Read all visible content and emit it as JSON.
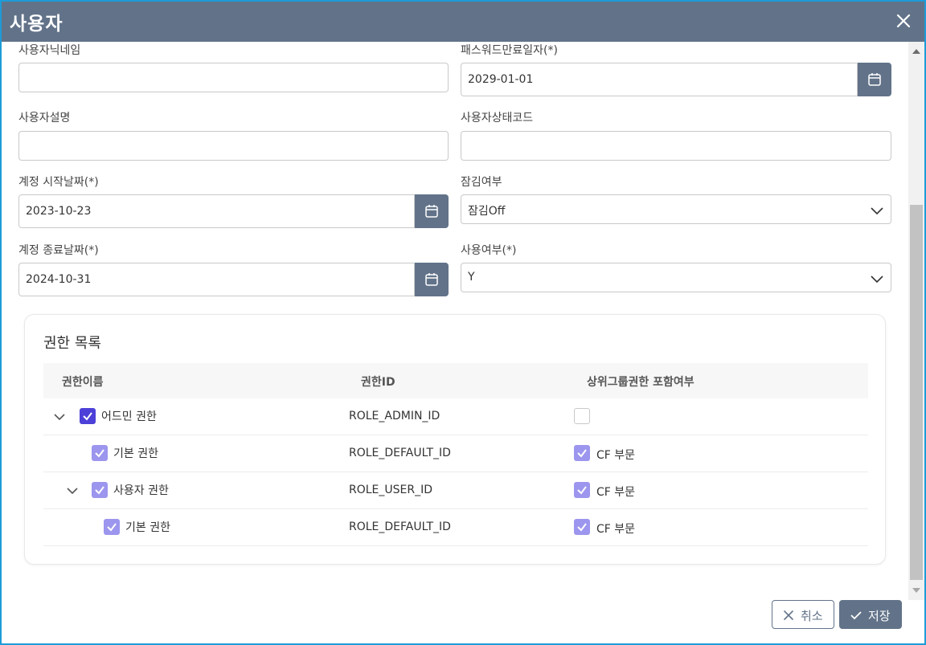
{
  "window": {
    "title": "사용자"
  },
  "form": {
    "nickname": {
      "label": "사용자닉네임",
      "value": ""
    },
    "password_expiry": {
      "label": "패스워드만료일자(*)",
      "value": "2029-01-01"
    },
    "description": {
      "label": "사용자설명",
      "value": ""
    },
    "status_code": {
      "label": "사용자상태코드",
      "value": ""
    },
    "start_date": {
      "label": "계정 시작날짜(*)",
      "value": "2023-10-23"
    },
    "lock": {
      "label": "잠김여부",
      "value": "잠김Off"
    },
    "end_date": {
      "label": "계정 종료날짜(*)",
      "value": "2024-10-31"
    },
    "use": {
      "label": "사용여부(*)",
      "value": "Y"
    }
  },
  "roles": {
    "title": "권한 목록",
    "columns": [
      "권한이름",
      "권한ID",
      "상위그룹권한 포함여부"
    ],
    "rows": [
      {
        "name": "어드민 권한",
        "id": "ROLE_ADMIN_ID",
        "include": "",
        "checked": true,
        "include_checked": false,
        "expanded": true,
        "level": 0
      },
      {
        "name": "기본 권한",
        "id": "ROLE_DEFAULT_ID",
        "include": "CF 부문",
        "checked": true,
        "include_checked": true,
        "level": 1
      },
      {
        "name": "사용자 권한",
        "id": "ROLE_USER_ID",
        "include": "CF 부문",
        "checked": true,
        "include_checked": true,
        "expanded": true,
        "level": 1
      },
      {
        "name": "기본 권한",
        "id": "ROLE_DEFAULT_ID",
        "include": "CF 부문",
        "checked": true,
        "include_checked": true,
        "level": 2
      }
    ]
  },
  "footer": {
    "cancel_label": "취소",
    "save_label": "저장"
  },
  "colors": {
    "titlebar": "#627389",
    "frame": "#1d9bd8",
    "checkbox_checked": "#9c96ee",
    "checkbox_checked_strong": "#4c40d8"
  }
}
